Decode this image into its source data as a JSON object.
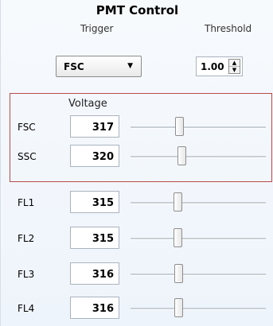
{
  "title": "PMT Control",
  "trigger": {
    "header": "Trigger",
    "selected": "FSC",
    "arrow_icon": "dropdown-arrow-icon"
  },
  "threshold": {
    "header": "Threshold",
    "value": "1.00"
  },
  "voltage_header": "Voltage",
  "channels": [
    {
      "label": "FSC",
      "value": "317",
      "slider_level": 0.35
    },
    {
      "label": "SSC",
      "value": "320",
      "slider_level": 0.37
    },
    {
      "label": "FL1",
      "value": "315",
      "slider_level": 0.34
    },
    {
      "label": "FL2",
      "value": "315",
      "slider_level": 0.34
    },
    {
      "label": "FL3",
      "value": "316",
      "slider_level": 0.345
    },
    {
      "label": "FL4",
      "value": "316",
      "slider_level": 0.345
    }
  ],
  "colors": {
    "group_border": "#b84a4a",
    "background": "#f4f8fc"
  }
}
